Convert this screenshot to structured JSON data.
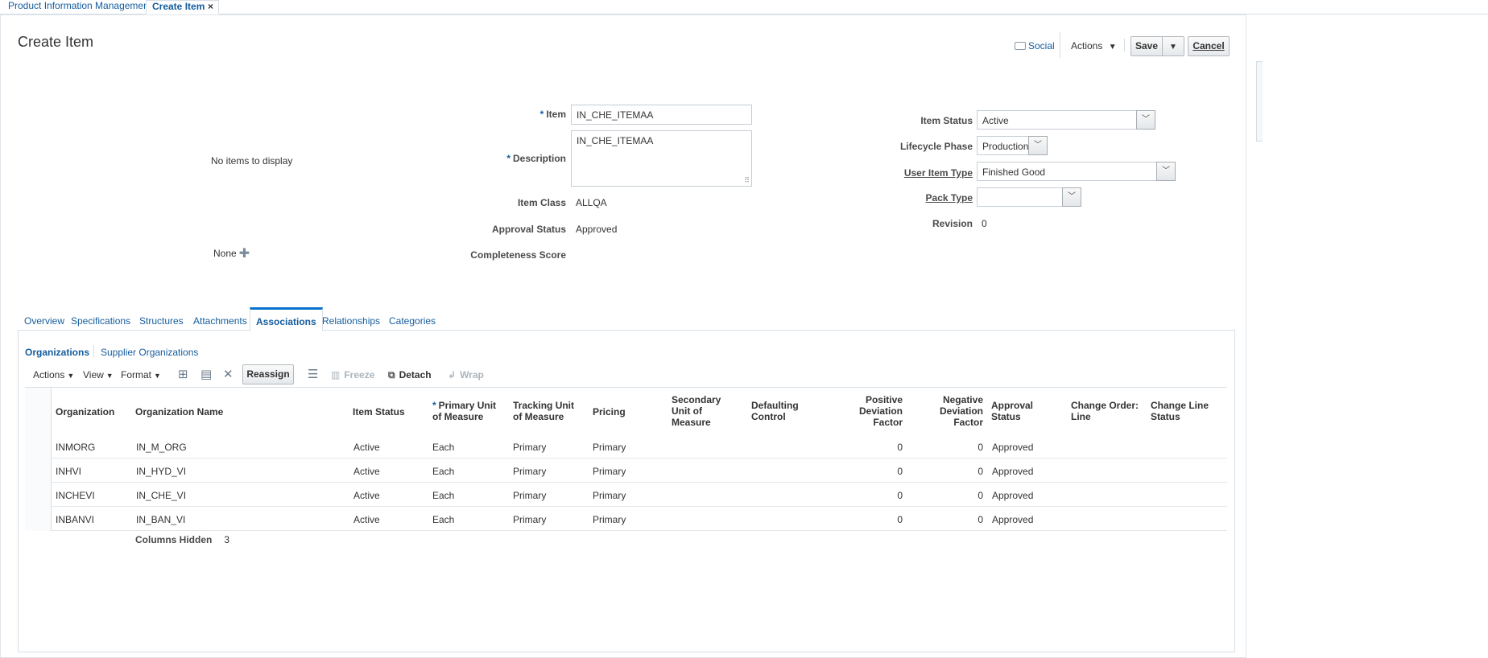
{
  "top_tabs": {
    "tab1": "Product Information Management",
    "tab2": "Create Item",
    "close": "×"
  },
  "header": {
    "title": "Create Item",
    "social": "Social",
    "actions": "Actions",
    "save": "Save",
    "cancel": "Cancel"
  },
  "left": {
    "no_items": "No items to display",
    "none": "None"
  },
  "form": {
    "item_label": "Item",
    "item_value": "IN_CHE_ITEMAA",
    "description_label": "Description",
    "description_value": "IN_CHE_ITEMAA",
    "item_class_label": "Item Class",
    "item_class_value": "ALLQA",
    "approval_status_label": "Approval Status",
    "approval_status_value": "Approved",
    "completeness_label": "Completeness Score",
    "item_status_label": "Item Status",
    "item_status_value": "Active",
    "lifecycle_label": "Lifecycle Phase",
    "lifecycle_value": "Production",
    "user_item_type_label": "User Item Type",
    "user_item_type_value": "Finished Good",
    "pack_type_label": "Pack Type",
    "pack_type_value": "",
    "revision_label": "Revision",
    "revision_value": "0"
  },
  "tabs": [
    "Overview",
    "Specifications",
    "Structures",
    "Attachments",
    "Associations",
    "Relationships",
    "Categories"
  ],
  "subtabs": [
    "Organizations",
    "Supplier Organizations"
  ],
  "toolbar": {
    "actions": "Actions",
    "view": "View",
    "format": "Format",
    "reassign": "Reassign",
    "freeze": "Freeze",
    "detach": "Detach",
    "wrap": "Wrap"
  },
  "table": {
    "headers": {
      "organization": "Organization",
      "organization_name": "Organization Name",
      "item_status": "Item Status",
      "primary_uom_1": "Primary Unit",
      "primary_uom_2": "of Measure",
      "tracking_uom_1": "Tracking Unit",
      "tracking_uom_2": "of Measure",
      "pricing": "Pricing",
      "secondary_1": "Secondary",
      "secondary_2": "Unit of",
      "secondary_3": "Measure",
      "defaulting_1": "Defaulting",
      "defaulting_2": "Control",
      "positive_1": "Positive",
      "positive_2": "Deviation",
      "positive_3": "Factor",
      "negative_1": "Negative",
      "negative_2": "Deviation",
      "negative_3": "Factor",
      "approval_1": "Approval",
      "approval_2": "Status",
      "co_line_1": "Change Order:",
      "co_line_2": "Line",
      "cl_status_1": "Change Line",
      "cl_status_2": "Status"
    },
    "rows": [
      {
        "org": "INMORG",
        "name": "IN_M_ORG",
        "status": "Active",
        "puom": "Each",
        "tuom": "Primary",
        "pricing": "Primary",
        "pos": "0",
        "neg": "0",
        "approval": "Approved"
      },
      {
        "org": "INHVI",
        "name": "IN_HYD_VI",
        "status": "Active",
        "puom": "Each",
        "tuom": "Primary",
        "pricing": "Primary",
        "pos": "0",
        "neg": "0",
        "approval": "Approved"
      },
      {
        "org": "INCHEVI",
        "name": "IN_CHE_VI",
        "status": "Active",
        "puom": "Each",
        "tuom": "Primary",
        "pricing": "Primary",
        "pos": "0",
        "neg": "0",
        "approval": "Approved"
      },
      {
        "org": "INBANVI",
        "name": "IN_BAN_VI",
        "status": "Active",
        "puom": "Each",
        "tuom": "Primary",
        "pricing": "Primary",
        "pos": "0",
        "neg": "0",
        "approval": "Approved"
      }
    ],
    "columns_hidden_label": "Columns Hidden",
    "columns_hidden_value": "3"
  }
}
